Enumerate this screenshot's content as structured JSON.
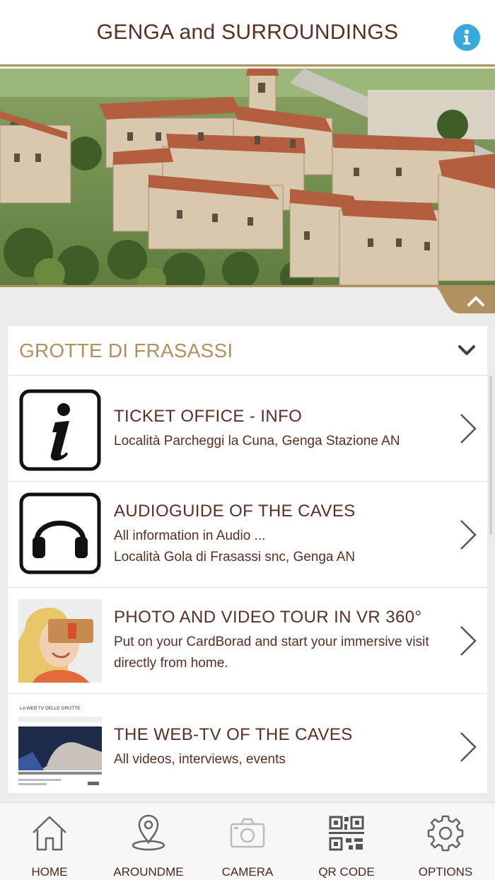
{
  "header": {
    "title": "GENGA and SURROUNDINGS",
    "info_icon": "info-icon",
    "accent_color": "#b0915f",
    "title_color": "#5a2f24"
  },
  "hero": {
    "icon": "collapse-chevron-up-icon"
  },
  "section": {
    "title": "GROTTE DI FRASASSI",
    "toggle_icon": "chevron-down-icon",
    "items": [
      {
        "title": "TICKET OFFICE - INFO",
        "lines": [
          "Località Parcheggi la Cuna, Genga Stazione AN"
        ],
        "icon": "info-icon"
      },
      {
        "title": "AUDIOGUIDE OF THE CAVES",
        "lines": [
          "All information in Audio ...",
          "Località Gola di Frasassi snc, Genga AN"
        ],
        "icon": "headphones-icon"
      },
      {
        "title": "PHOTO AND VIDEO TOUR IN VR 360°",
        "lines": [
          "Put on your CardBorad and start your immersive visit",
          "directly from home."
        ],
        "icon": "vr-headset-photo"
      },
      {
        "title": "THE WEB-TV OF THE CAVES",
        "lines": [
          "All videos, interviews, events"
        ],
        "thumb_caption": "LA WEB TV DELLE GROTTE",
        "icon": "web-tv-thumbnail"
      }
    ]
  },
  "tabbar": {
    "tabs": [
      {
        "label": "HOME",
        "icon": "home-icon"
      },
      {
        "label": "AROUNDME",
        "icon": "location-pin-icon"
      },
      {
        "label": "CAMERA",
        "icon": "camera-icon"
      },
      {
        "label": "QR CODE",
        "icon": "qr-code-icon"
      },
      {
        "label": "OPTIONS",
        "icon": "gear-icon"
      }
    ]
  }
}
